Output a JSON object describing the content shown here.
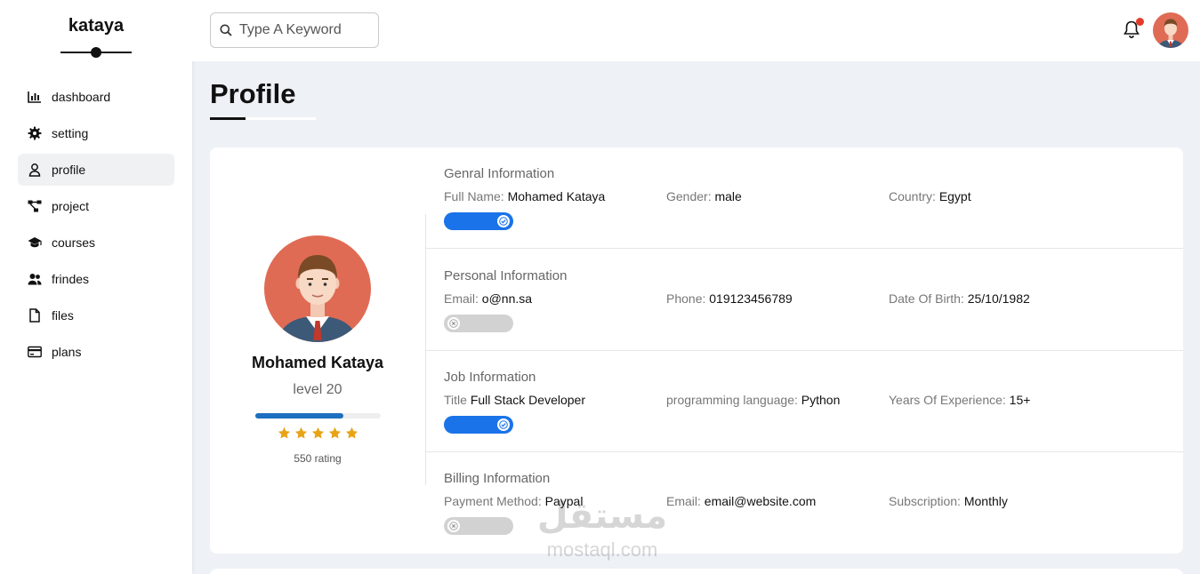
{
  "brand": {
    "name": "kataya"
  },
  "sidebar": {
    "items": [
      {
        "label": "dashboard",
        "icon": "chart-icon"
      },
      {
        "label": "setting",
        "icon": "gear-icon"
      },
      {
        "label": "profile",
        "icon": "user-icon",
        "active": true
      },
      {
        "label": "project",
        "icon": "diagram-icon"
      },
      {
        "label": "courses",
        "icon": "graduation-cap-icon"
      },
      {
        "label": "frindes",
        "icon": "users-icon"
      },
      {
        "label": "files",
        "icon": "file-icon"
      },
      {
        "label": "plans",
        "icon": "credit-card-icon"
      }
    ]
  },
  "header": {
    "search_placeholder": "Type A Keyword",
    "has_notification": true
  },
  "page": {
    "title": "Profile"
  },
  "profile": {
    "name": "Mohamed Kataya",
    "level": "level 20",
    "level_progress_percent": 70,
    "stars": 5,
    "rating_text": "550 rating"
  },
  "sections": [
    {
      "title": "Genral Information",
      "fields": [
        {
          "label": "Full Name:",
          "value": "Mohamed Kataya"
        },
        {
          "label": "Gender:",
          "value": "male"
        },
        {
          "label": "Country:",
          "value": "Egypt"
        }
      ],
      "toggle_on": true
    },
    {
      "title": "Personal Information",
      "fields": [
        {
          "label": "Email:",
          "value": "o@nn.sa"
        },
        {
          "label": "Phone:",
          "value": "019123456789"
        },
        {
          "label": "Date Of Birth:",
          "value": "25/10/1982"
        }
      ],
      "toggle_on": false
    },
    {
      "title": "Job Information",
      "fields": [
        {
          "label": "Title",
          "value": "Full Stack Developer"
        },
        {
          "label": "programming language:",
          "value": "Python"
        },
        {
          "label": "Years Of Experience:",
          "value": "15+"
        }
      ],
      "toggle_on": true
    },
    {
      "title": "Billing Information",
      "fields": [
        {
          "label": "Payment Method:",
          "value": "Paypal"
        },
        {
          "label": "Email:",
          "value": "email@website.com"
        },
        {
          "label": "Subscription:",
          "value": "Monthly"
        }
      ],
      "toggle_on": false
    }
  ],
  "watermark": {
    "arabic": "مستقل",
    "latin": "mostaql.com"
  },
  "colors": {
    "accent": "#1a73e8",
    "progress": "#1d6fbf",
    "star": "#e8a317",
    "notification": "#e23b2b",
    "avatar_bg": "#e06b55"
  }
}
